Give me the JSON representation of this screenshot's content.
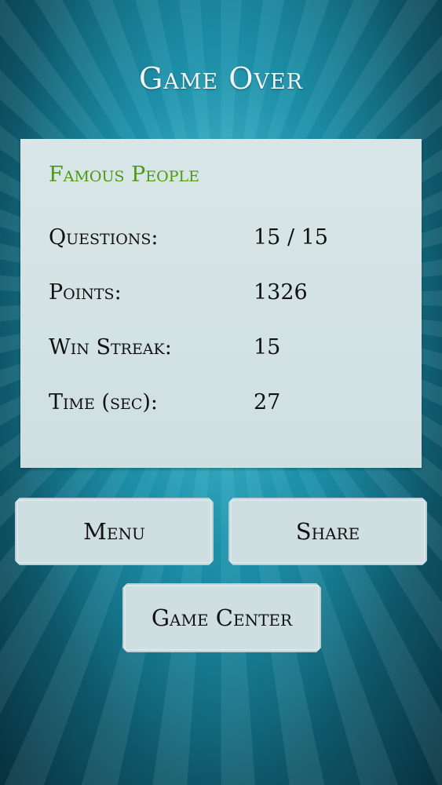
{
  "screen": {
    "title": "Game Over"
  },
  "results": {
    "category": "Famous People",
    "stats": [
      {
        "label": "Questions:",
        "value": "15 / 15"
      },
      {
        "label": "Points:",
        "value": "1326"
      },
      {
        "label": "Win Streak:",
        "value": "15"
      },
      {
        "label": "Time (sec):",
        "value": "27"
      }
    ]
  },
  "buttons": {
    "menu": "Menu",
    "share": "Share",
    "game_center": "Game Center"
  },
  "colors": {
    "background": "#17839c",
    "panel": "#cfdfe1",
    "category_text": "#4a9a12"
  }
}
